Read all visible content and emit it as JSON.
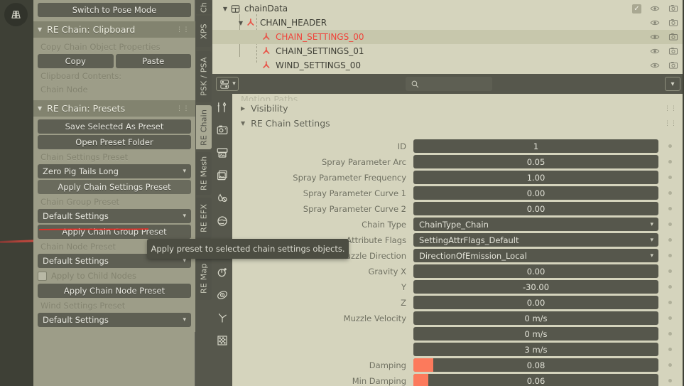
{
  "app": {
    "theme_accent": "#fc7a5c",
    "panel_bg": "#9d9d88",
    "editor_bg": "#d5d4bd",
    "widget_bg": "#56574c"
  },
  "viewport": {
    "overlay_icon": "grid-floor-icon",
    "annotation_color": "#b5433a"
  },
  "sidebar": {
    "top_button": "Switch to Pose Mode",
    "panels": [
      {
        "title": "RE Chain: Clipboard",
        "items": [
          {
            "kind": "label",
            "name": "copy-chain-object-properties-label",
            "text": "Copy Chain Object Properties"
          },
          {
            "kind": "button_pair",
            "left": "Copy",
            "right": "Paste"
          },
          {
            "kind": "label",
            "name": "clipboard-contents-label",
            "text": "Clipboard Contents:"
          },
          {
            "kind": "label",
            "name": "clipboard-contents-value",
            "text": "Chain Node"
          }
        ]
      },
      {
        "title": "RE Chain: Presets",
        "items": [
          {
            "kind": "button",
            "name": "save-selected-as-preset-button",
            "text": "Save Selected As Preset"
          },
          {
            "kind": "button",
            "name": "open-preset-folder-button",
            "text": "Open Preset Folder"
          },
          {
            "kind": "label",
            "name": "chain-settings-preset-label",
            "text": "Chain Settings Preset"
          },
          {
            "kind": "dropdown",
            "name": "chain-settings-preset-dropdown",
            "text": "Zero Pig Tails Long"
          },
          {
            "kind": "button",
            "name": "apply-chain-settings-preset-button",
            "text": "Apply Chain Settings Preset",
            "highlighted": true
          },
          {
            "kind": "label",
            "name": "chain-group-preset-label",
            "text": "Chain Group Preset"
          },
          {
            "kind": "dropdown",
            "name": "chain-group-preset-dropdown",
            "text": "Default Settings"
          },
          {
            "kind": "button",
            "name": "apply-chain-group-preset-button",
            "text": "Apply Chain Group Preset"
          },
          {
            "kind": "label",
            "name": "chain-node-preset-label",
            "text": "Chain Node Preset"
          },
          {
            "kind": "dropdown",
            "name": "chain-node-preset-dropdown",
            "text": "Default Settings"
          },
          {
            "kind": "checkbox",
            "name": "apply-to-child-nodes-checkbox",
            "text": "Apply to Child Nodes",
            "checked": false
          },
          {
            "kind": "button",
            "name": "apply-chain-node-preset-button",
            "text": "Apply Chain Node Preset"
          },
          {
            "kind": "label",
            "name": "wind-settings-preset-label",
            "text": "Wind Settings Preset"
          },
          {
            "kind": "dropdown",
            "name": "wind-settings-preset-dropdown",
            "text": "Default Settings"
          }
        ]
      }
    ]
  },
  "tooltip": {
    "text": "Apply preset to selected chain settings objects."
  },
  "vtabs_upper": [
    {
      "label": "Ch",
      "active": false
    },
    {
      "label": "XPS",
      "active": false
    },
    {
      "label": "PSK / PSA",
      "active": false
    },
    {
      "label": "RE Chain",
      "active": true
    },
    {
      "label": "RE Mesh",
      "active": false
    },
    {
      "label": "RE EFX",
      "active": false
    },
    {
      "label": "RE Map",
      "active": false
    }
  ],
  "outliner": {
    "rows": [
      {
        "name": "chainData",
        "depth": 0,
        "icon": "collection-icon",
        "expanded": true,
        "selected": false,
        "red": false,
        "checkbox": true
      },
      {
        "name": "CHAIN_HEADER",
        "depth": 1,
        "icon": "armature-icon",
        "expanded": true,
        "selected": false,
        "red": false,
        "checkbox": false
      },
      {
        "name": "CHAIN_SETTINGS_00",
        "depth": 2,
        "icon": "armature-icon",
        "expanded": null,
        "selected": true,
        "red": true,
        "checkbox": false
      },
      {
        "name": "CHAIN_SETTINGS_01",
        "depth": 2,
        "icon": "armature-icon",
        "expanded": null,
        "selected": false,
        "red": false,
        "checkbox": false
      },
      {
        "name": "WIND_SETTINGS_00",
        "depth": 2,
        "icon": "armature-icon",
        "expanded": null,
        "selected": false,
        "red": false,
        "checkbox": false
      }
    ],
    "row_icons": [
      "eye-icon",
      "camera-icon"
    ]
  },
  "properties": {
    "header": {
      "pin_icon": "editor-type-icon",
      "search_placeholder": "",
      "search_value": "",
      "search_icon": "search-icon",
      "chevron": "chevron-down-icon"
    },
    "icon_tabs": [
      {
        "name": "tool-icon",
        "active": false
      },
      {
        "name": "render-icon",
        "active": false
      },
      {
        "name": "output-icon",
        "active": false
      },
      {
        "name": "view-layer-icon",
        "active": false
      },
      {
        "name": "scene-icon",
        "active": false
      },
      {
        "name": "world-icon",
        "active": false
      },
      {
        "name": "object-icon",
        "active": true
      },
      {
        "name": "modifier-icon",
        "active": false
      },
      {
        "name": "physics-icon",
        "active": false
      },
      {
        "name": "object-constraint-icon",
        "active": false
      },
      {
        "name": "object-data-icon",
        "active": false
      }
    ],
    "sections": [
      {
        "name": "motion-paths-section",
        "title": "Motion Paths",
        "expanded": false,
        "clipped": true
      },
      {
        "name": "visibility-section",
        "title": "Visibility",
        "expanded": false,
        "clipped": false
      },
      {
        "name": "re-chain-settings-section",
        "title": "RE Chain Settings",
        "expanded": true,
        "clipped": false
      }
    ],
    "fields": [
      {
        "label": "ID",
        "value": "1",
        "type": "number",
        "align": "center"
      },
      {
        "label": "Spray Parameter Arc",
        "value": "0.05",
        "type": "number",
        "align": "center"
      },
      {
        "label": "Spray Parameter Frequency",
        "value": "1.00",
        "type": "number",
        "align": "center"
      },
      {
        "label": "Spray Parameter Curve 1",
        "value": "0.00",
        "type": "number",
        "align": "center"
      },
      {
        "label": "Spray Parameter Curve 2",
        "value": "0.00",
        "type": "number",
        "align": "center"
      },
      {
        "label": "Chain Type",
        "value": "ChainType_Chain",
        "type": "enum",
        "align": "left"
      },
      {
        "label": "Attribute Flags",
        "value": "SettingAttrFlags_Default",
        "type": "enum",
        "align": "left"
      },
      {
        "label": "Muzzle Direction",
        "value": "DirectionOfEmission_Local",
        "type": "enum",
        "align": "left"
      },
      {
        "label": "Gravity X",
        "value": "0.00",
        "type": "number",
        "align": "center"
      },
      {
        "label": "Y",
        "value": "-30.00",
        "type": "number",
        "align": "center"
      },
      {
        "label": "Z",
        "value": "0.00",
        "type": "number",
        "align": "center"
      },
      {
        "label": "Muzzle Velocity",
        "value": "0 m/s",
        "type": "number",
        "align": "center"
      },
      {
        "label": "",
        "value": "0 m/s",
        "type": "number",
        "align": "center"
      },
      {
        "label": "",
        "value": "3 m/s",
        "type": "number",
        "align": "center"
      },
      {
        "label": "Damping",
        "value": "0.08",
        "type": "slider",
        "align": "center",
        "fill": 8
      },
      {
        "label": "Min Damping",
        "value": "0.06",
        "type": "slider",
        "align": "center",
        "fill": 6
      }
    ]
  }
}
